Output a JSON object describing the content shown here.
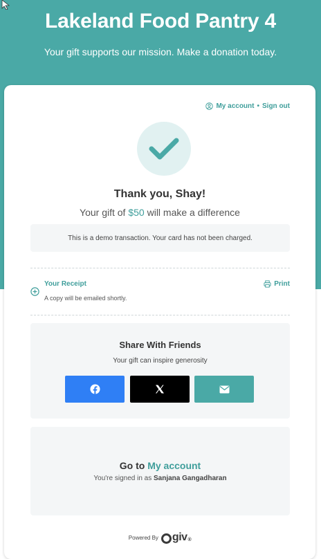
{
  "header": {
    "title": "Lakeland Food Pantry 4",
    "subtitle": "Your gift supports our mission. Make a donation today."
  },
  "account": {
    "my_account": "My account",
    "separator": "•",
    "sign_out": "Sign out"
  },
  "confirmation": {
    "thanks": "Thank you, Shay!",
    "gift_prefix": "Your gift of ",
    "gift_amount": "$50",
    "gift_suffix": " will make a difference",
    "demo_notice": "This is a demo transaction. Your card has not been charged."
  },
  "receipt": {
    "title": "Your Receipt",
    "note": "A copy will be emailed shortly.",
    "print_label": "Print"
  },
  "share": {
    "title": "Share With Friends",
    "subtitle": "Your gift can inspire generosity",
    "buttons": [
      {
        "network": "Facebook",
        "icon": "facebook-icon",
        "color": "#2f7ff5"
      },
      {
        "network": "X",
        "icon": "x-icon",
        "color": "#000000"
      },
      {
        "network": "Email",
        "icon": "envelope-icon",
        "color": "#4aa9a6"
      }
    ]
  },
  "account_panel": {
    "goto_prefix": "Go to ",
    "goto_link": "My account",
    "signed_prefix": "You're signed in as ",
    "signed_name": "Sanjana Gangadharan"
  },
  "footer": {
    "powered_by": "Powered By",
    "logo_text": "giv",
    "logo_reg": "®"
  },
  "colors": {
    "brand": "#4aa9a6",
    "accent_text": "#3f9e9b",
    "panel_bg": "#f4f6f7"
  }
}
